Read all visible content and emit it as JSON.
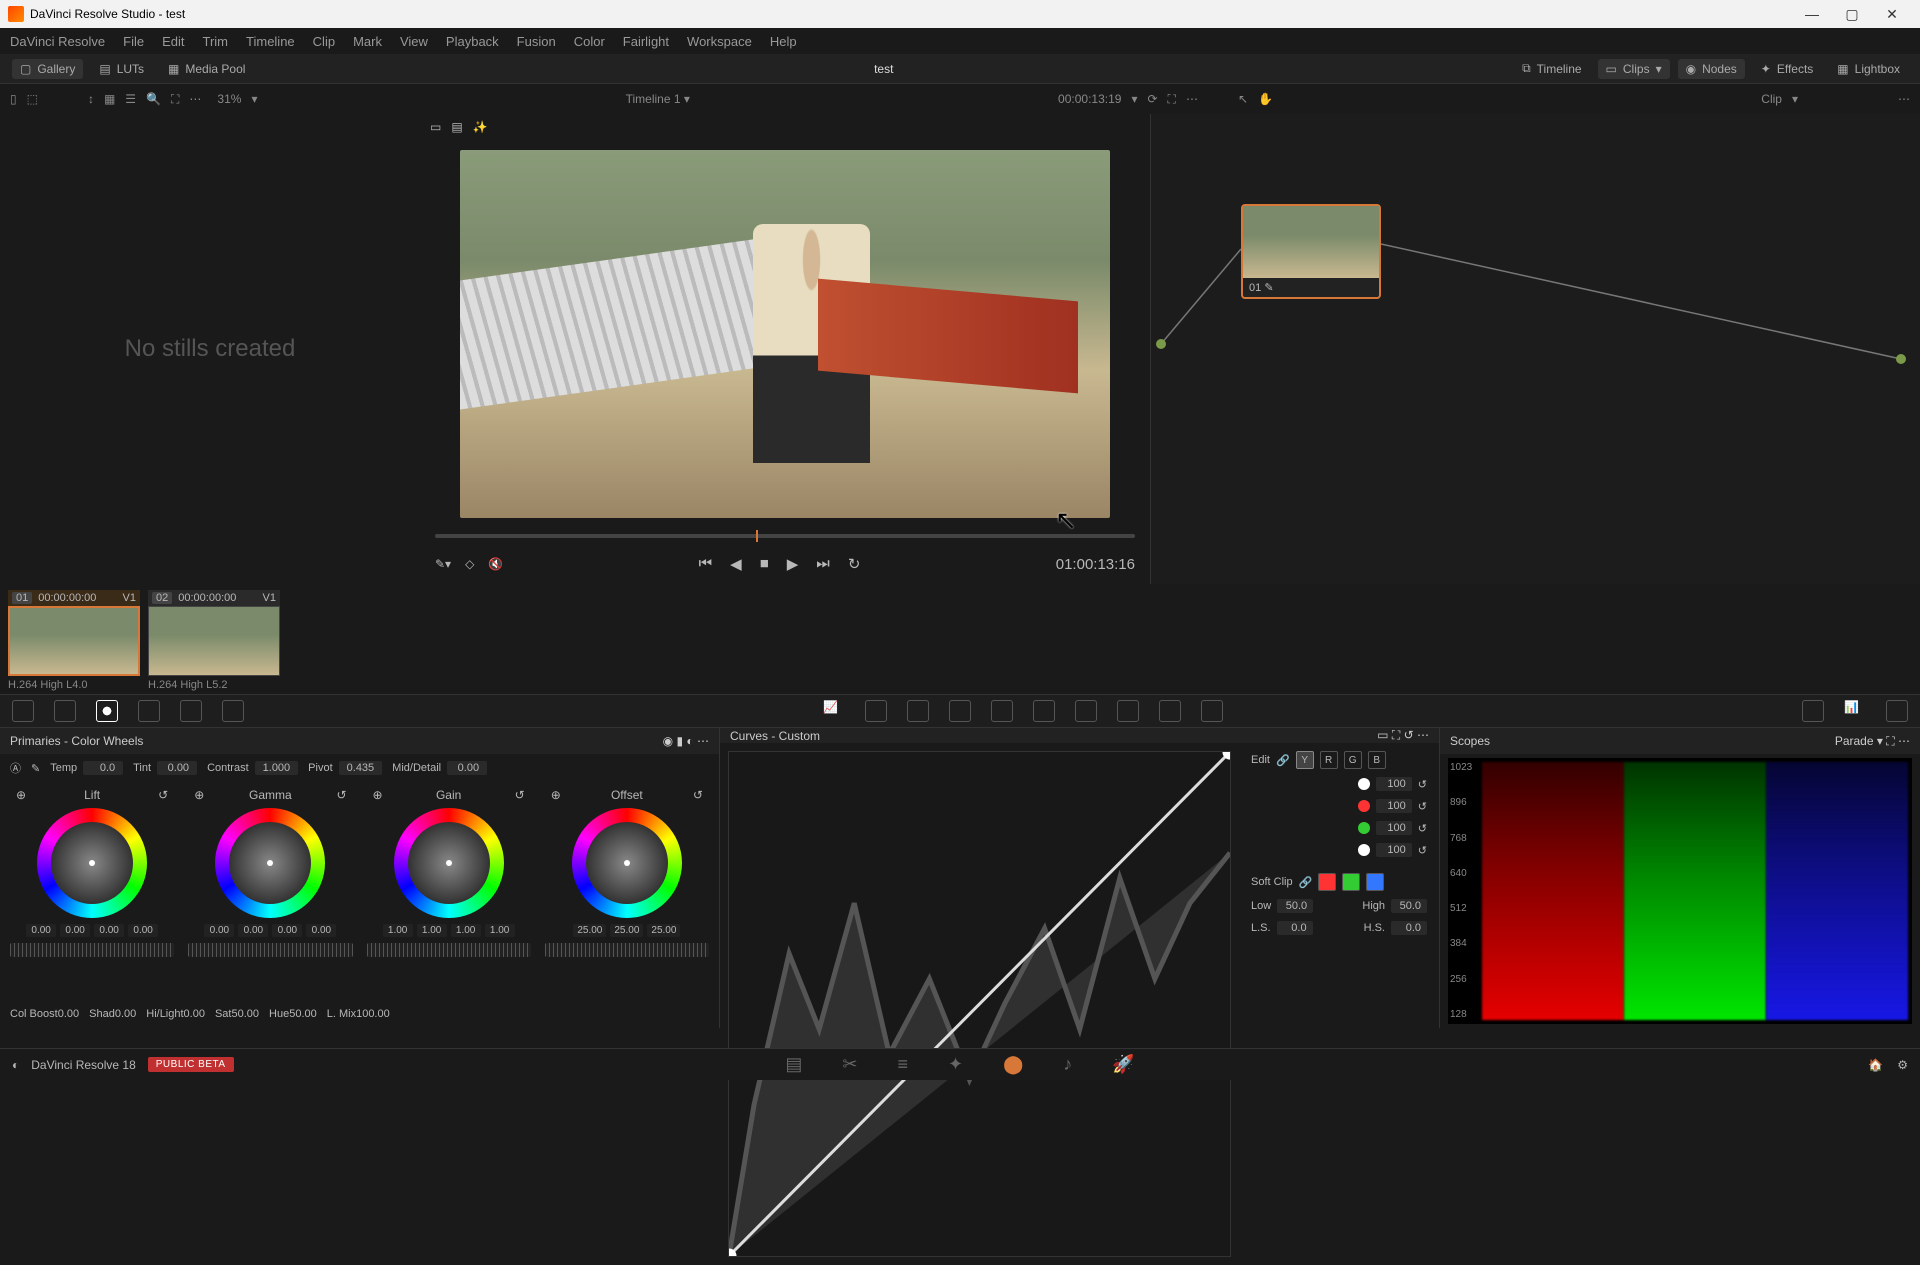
{
  "titlebar": {
    "label": "DaVinci Resolve Studio - test"
  },
  "menus": [
    "DaVinci Resolve",
    "File",
    "Edit",
    "Trim",
    "Timeline",
    "Clip",
    "Mark",
    "View",
    "Playback",
    "Fusion",
    "Color",
    "Fairlight",
    "Workspace",
    "Help"
  ],
  "toolbar": {
    "gallery": "Gallery",
    "luts": "LUTs",
    "mediapool": "Media Pool",
    "project": "test",
    "timeline": "Timeline",
    "clips": "Clips",
    "nodes": "Nodes",
    "effects": "Effects",
    "lightbox": "Lightbox"
  },
  "subtoolbar": {
    "zoom": "31%",
    "timeline_name": "Timeline 1",
    "record_tc": "00:00:13:19",
    "node_mode": "Clip"
  },
  "gallery_empty": "No stills created",
  "transport_tc": "01:00:13:16",
  "node": {
    "label": "01"
  },
  "clips": [
    {
      "num": "01",
      "tc": "00:00:00:00",
      "track": "V1",
      "codec": "H.264 High L4.0",
      "selected": true
    },
    {
      "num": "02",
      "tc": "00:00:00:00",
      "track": "V1",
      "codec": "H.264 High L5.2",
      "selected": false
    }
  ],
  "primaries": {
    "title": "Primaries - Color Wheels",
    "adjust": {
      "temp_l": "Temp",
      "temp": "0.0",
      "tint_l": "Tint",
      "tint": "0.00",
      "contrast_l": "Contrast",
      "contrast": "1.000",
      "pivot_l": "Pivot",
      "pivot": "0.435",
      "md_l": "Mid/Detail",
      "md": "0.00"
    },
    "wheels": [
      {
        "name": "Lift",
        "vals": [
          "0.00",
          "0.00",
          "0.00",
          "0.00"
        ]
      },
      {
        "name": "Gamma",
        "vals": [
          "0.00",
          "0.00",
          "0.00",
          "0.00"
        ]
      },
      {
        "name": "Gain",
        "vals": [
          "1.00",
          "1.00",
          "1.00",
          "1.00"
        ]
      },
      {
        "name": "Offset",
        "vals": [
          "25.00",
          "25.00",
          "25.00"
        ]
      }
    ],
    "bottom": {
      "cb_l": "Col Boost",
      "cb": "0.00",
      "shad_l": "Shad",
      "shad": "0.00",
      "hl_l": "Hi/Light",
      "hl": "0.00",
      "sat_l": "Sat",
      "sat": "50.00",
      "hue_l": "Hue",
      "hue": "50.00",
      "lmix_l": "L. Mix",
      "lmix": "100.00"
    }
  },
  "curves": {
    "title": "Curves - Custom",
    "edit": "Edit",
    "ch_y": "Y",
    "ch_r": "R",
    "ch_g": "G",
    "ch_b": "B",
    "intensities": [
      "100",
      "100",
      "100",
      "100"
    ],
    "softclip": "Soft Clip",
    "low_l": "Low",
    "low": "50.0",
    "high_l": "High",
    "high": "50.0",
    "ls_l": "L.S.",
    "ls": "0.0",
    "hs_l": "H.S.",
    "hs": "0.0"
  },
  "scopes": {
    "title": "Scopes",
    "mode": "Parade",
    "ticks": [
      "1023",
      "896",
      "768",
      "640",
      "512",
      "384",
      "256",
      "128"
    ]
  },
  "footer": {
    "app": "DaVinci Resolve 18",
    "badge": "PUBLIC BETA"
  }
}
